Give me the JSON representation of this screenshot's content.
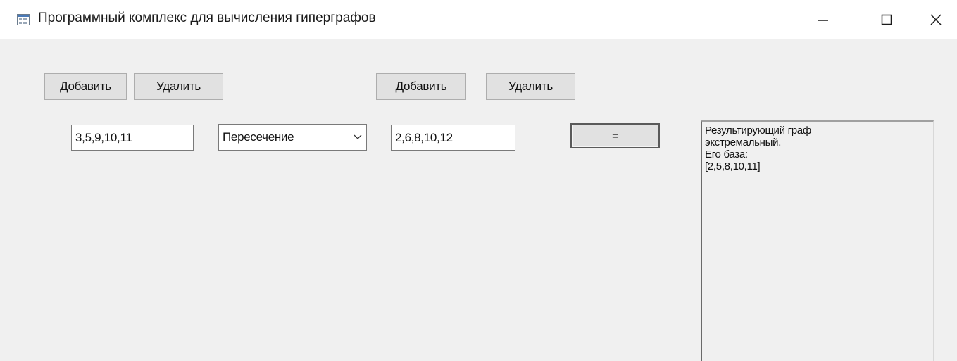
{
  "window": {
    "title": "Программный комплекс для вычисления гиперграфов",
    "app_icon": "form-icon",
    "controls": {
      "minimize_icon": "minimize-icon",
      "maximize_icon": "maximize-icon",
      "close_icon": "close-icon"
    }
  },
  "left_group": {
    "add_label": "Добавить",
    "remove_label": "Удалить",
    "input_value": "3,5,9,10,11"
  },
  "operation": {
    "selected": "Пересечение",
    "arrow_icon": "chevron-down-icon"
  },
  "right_group": {
    "add_label": "Добавить",
    "remove_label": "Удалить",
    "input_value": "2,6,8,10,12"
  },
  "compute_button": {
    "label": "="
  },
  "result": {
    "text": "Результирующий граф\nэкстремальный.\nЕго база:\n[2,5,8,10,11]"
  }
}
